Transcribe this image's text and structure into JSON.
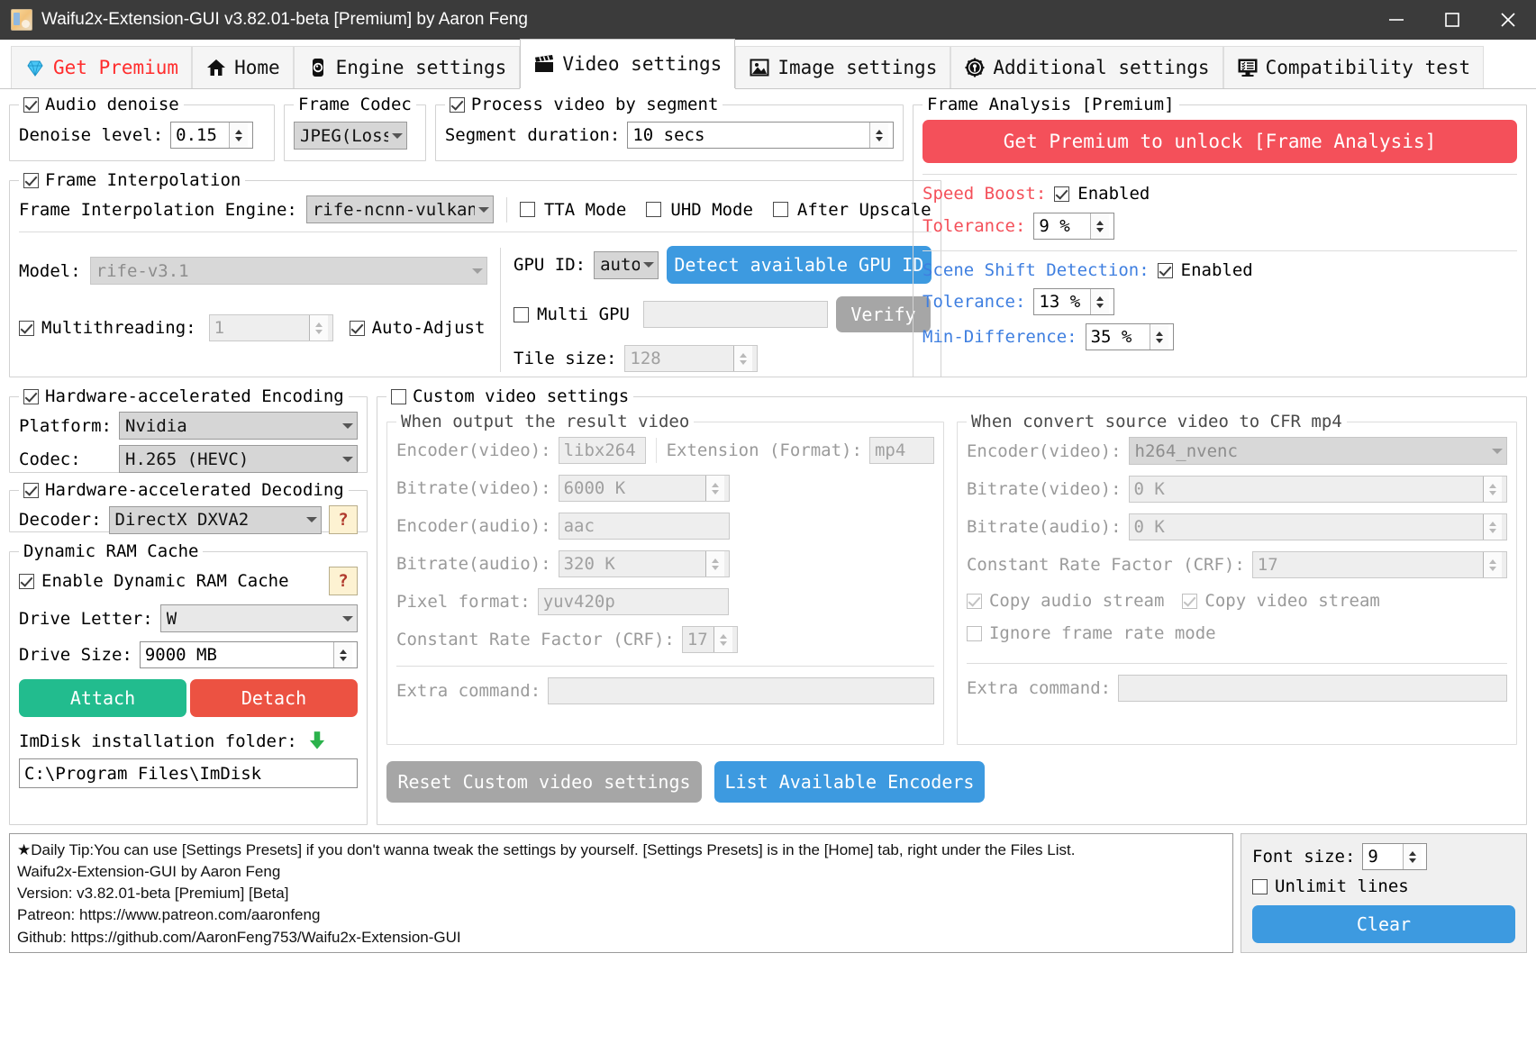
{
  "window": {
    "title": "Waifu2x-Extension-GUI v3.82.01-beta [Premium] by Aaron Feng",
    "minimize": "─",
    "maximize": "□",
    "close": "✕"
  },
  "tabs": [
    {
      "label": "Get Premium",
      "icon": "diamond-icon",
      "active": false,
      "premium": true
    },
    {
      "label": "Home",
      "icon": "home-icon",
      "active": false
    },
    {
      "label": "Engine settings",
      "icon": "engine-icon",
      "active": false
    },
    {
      "label": "Video settings",
      "icon": "clapperboard-icon",
      "active": true
    },
    {
      "label": "Image settings",
      "icon": "picture-icon",
      "active": false
    },
    {
      "label": "Additional settings",
      "icon": "gear-icon",
      "active": false
    },
    {
      "label": "Compatibility test",
      "icon": "monitor-list-icon",
      "active": false
    }
  ],
  "audio_denoise": {
    "group_label": "Audio denoise",
    "checked": true,
    "level_label": "Denoise level:",
    "level_value": "0.15"
  },
  "frame_codec": {
    "group_label": "Frame Codec",
    "value": "JPEG(Lossl"
  },
  "segment": {
    "group_label": "Process video by segment",
    "checked": true,
    "duration_label": "Segment duration:",
    "duration_value": "10 secs"
  },
  "frame_interpolation": {
    "group_label": "Frame Interpolation",
    "checked": true,
    "engine_label": "Frame Interpolation Engine:",
    "engine_value": "rife-ncnn-vulkan",
    "tta_label": "TTA Mode",
    "tta_checked": false,
    "uhd_label": "UHD Mode",
    "uhd_checked": false,
    "after_upscale_label": "After Upscale",
    "after_upscale_checked": false,
    "model_label": "Model:",
    "model_value": "rife-v3.1",
    "multithreading_label": "Multithreading:",
    "multithreading_checked": true,
    "multithreading_value": "1",
    "auto_adjust_label": "Auto-Adjust",
    "auto_adjust_checked": true,
    "gpu_id_label": "GPU ID:",
    "gpu_id_value": "auto",
    "detect_gpu_button": "Detect available GPU ID",
    "multi_gpu_label": "Multi GPU",
    "multi_gpu_checked": false,
    "multi_gpu_value": "",
    "verify_button": "Verify",
    "tile_size_label": "Tile size:",
    "tile_size_value": "128"
  },
  "frame_analysis": {
    "group_label": "Frame Analysis [Premium]",
    "unlock_button": "Get Premium to unlock [Frame Analysis]",
    "speed_boost_label": "Speed Boost:",
    "speed_boost_enabled_label": "Enabled",
    "speed_boost_checked": true,
    "speed_boost_tolerance_label": "Tolerance:",
    "speed_boost_tolerance_value": "9 %",
    "scene_shift_label": "Scene Shift Detection:",
    "scene_shift_enabled_label": "Enabled",
    "scene_shift_checked": true,
    "scene_shift_tolerance_label": "Tolerance:",
    "scene_shift_tolerance_value": "13 %",
    "min_difference_label": "Min-Difference:",
    "min_difference_value": "35 %"
  },
  "hw_encoding": {
    "group_label": "Hardware-accelerated Encoding",
    "checked": true,
    "platform_label": "Platform:",
    "platform_value": "Nvidia",
    "codec_label": "Codec:",
    "codec_value": "H.265 (HEVC)"
  },
  "hw_decoding": {
    "group_label": "Hardware-accelerated Decoding",
    "checked": true,
    "decoder_label": "Decoder:",
    "decoder_value": "DirectX DXVA2",
    "help_icon": "question-help-icon"
  },
  "ram_cache": {
    "group_label": "Dynamic RAM Cache",
    "enable_label": "Enable Dynamic RAM Cache",
    "enable_checked": true,
    "help_icon": "question-help-icon",
    "drive_letter_label": "Drive Letter:",
    "drive_letter_value": "W",
    "drive_size_label": "Drive Size:",
    "drive_size_value": "9000 MB",
    "attach_button": "Attach",
    "detach_button": "Detach",
    "imdisk_label": "ImDisk installation folder:",
    "download_icon": "download-icon",
    "imdisk_path": "C:\\Program Files\\ImDisk"
  },
  "custom_video": {
    "group_label": "Custom video settings",
    "checked": false,
    "output": {
      "group_label": "When output the result video",
      "encoder_video_label": "Encoder(video):",
      "encoder_video_value": "libx264",
      "extension_label": "Extension (Format):",
      "extension_value": "mp4",
      "bitrate_video_label": "Bitrate(video):",
      "bitrate_video_value": "6000 K",
      "encoder_audio_label": "Encoder(audio):",
      "encoder_audio_value": "aac",
      "bitrate_audio_label": "Bitrate(audio):",
      "bitrate_audio_value": "320 K",
      "pixel_format_label": "Pixel format:",
      "pixel_format_value": "yuv420p",
      "crf_label": "Constant Rate Factor (CRF):",
      "crf_value": "17",
      "extra_command_label": "Extra command:",
      "extra_command_value": ""
    },
    "cfr": {
      "group_label": "When convert source video to CFR mp4",
      "encoder_video_label": "Encoder(video):",
      "encoder_video_value": "h264_nvenc",
      "bitrate_video_label": "Bitrate(video):",
      "bitrate_video_value": "0 K",
      "bitrate_audio_label": "Bitrate(audio):",
      "bitrate_audio_value": "0 K",
      "crf_label": "Constant Rate Factor (CRF):",
      "crf_value": "17",
      "copy_audio_label": "Copy audio stream",
      "copy_audio_checked": true,
      "copy_video_label": "Copy video stream",
      "copy_video_checked": true,
      "ignore_frame_rate_label": "Ignore frame rate mode",
      "ignore_frame_rate_checked": false,
      "extra_command_label": "Extra command:",
      "extra_command_value": ""
    },
    "reset_button": "Reset Custom video settings",
    "list_encoders_button": "List Available Encoders"
  },
  "status": {
    "line1": "★Daily Tip:You can use [Settings Presets] if you don't wanna tweak the settings by yourself. [Settings Presets] is in the [Home] tab, right under the Files List.",
    "line2": "Waifu2x-Extension-GUI by Aaron Feng",
    "line3": "Version: v3.82.01-beta [Premium] [Beta]",
    "line4": "Patreon: https://www.patreon.com/aaronfeng",
    "line5": "Github: https://github.com/AaronFeng753/Waifu2x-Extension-GUI"
  },
  "footer": {
    "font_size_label": "Font size:",
    "font_size_value": "9",
    "unlimit_lines_label": "Unlimit lines",
    "unlimit_lines_checked": false,
    "clear_button": "Clear"
  },
  "colors": {
    "accent_blue": "#3d9ae0",
    "premium_red": "#f4505a",
    "green": "#22bc8e",
    "red": "#ec5242",
    "scene_blue": "#3f7fe0"
  }
}
